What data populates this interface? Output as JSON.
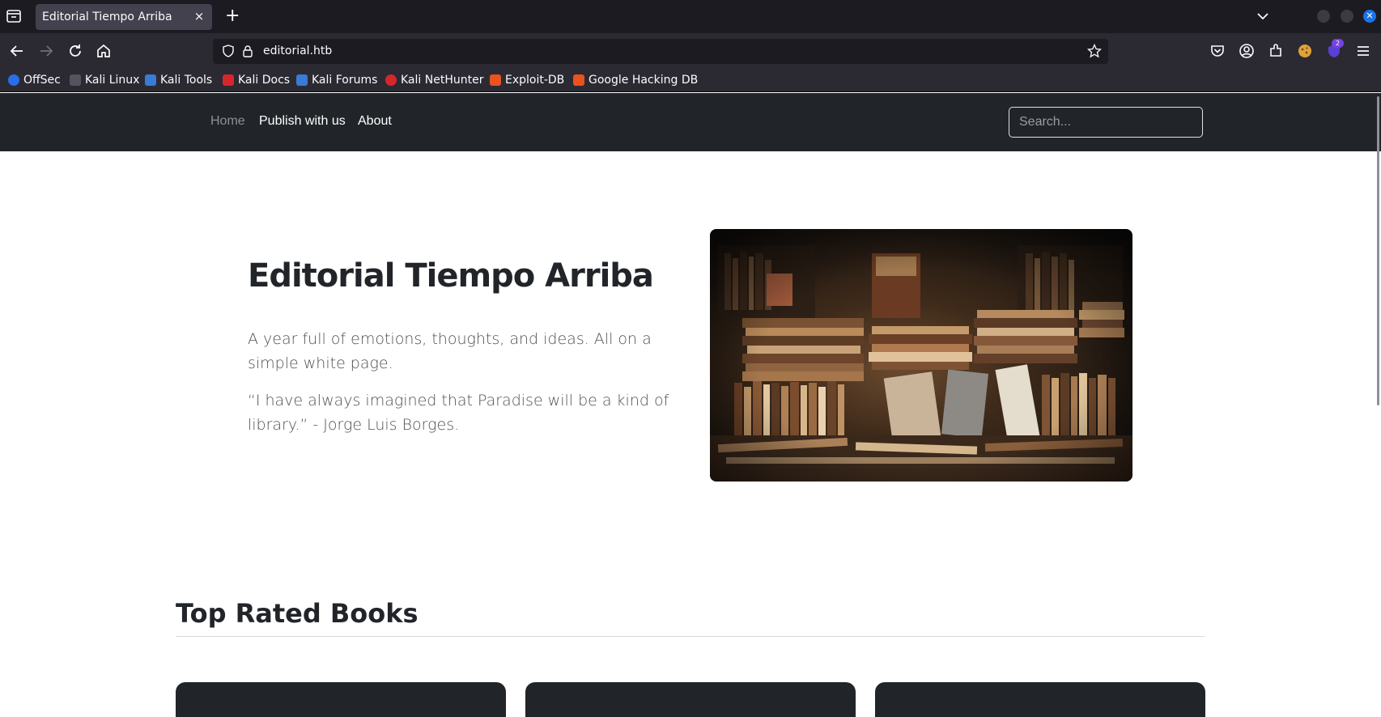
{
  "browser": {
    "tab_title": "Editorial Tiempo Arriba",
    "tab_close_glyph": "×",
    "new_tab_glyph": "+",
    "url": "editorial.htb",
    "extension_badge": "2",
    "bookmarks": [
      {
        "label": "OffSec",
        "color": "#2b6de8"
      },
      {
        "label": "Kali Linux",
        "color": "#2b2a33"
      },
      {
        "label": "Kali Tools",
        "color": "#3a7bd5"
      },
      {
        "label": "Kali Docs",
        "color": "#d6262b"
      },
      {
        "label": "Kali Forums",
        "color": "#3a7bd5"
      },
      {
        "label": "Kali NetHunter",
        "color": "#d6262b"
      },
      {
        "label": "Exploit-DB",
        "color": "#e8531f"
      },
      {
        "label": "Google Hacking DB",
        "color": "#e8531f"
      }
    ]
  },
  "site": {
    "nav": {
      "home": "Home",
      "publish": "Publish with us",
      "about": "About"
    },
    "search": {
      "placeholder": "Search..."
    },
    "hero": {
      "title": "Editorial Tiempo Arriba",
      "lead": "A year full of emotions, thoughts, and ideas. All on a simple white page.",
      "quote": "“I have always imagined that Paradise will be a kind of library.” - Jorge Luis Borges.",
      "image_alt": "stacks of old books in a bookshop"
    },
    "top_rated": {
      "title": "Top Rated Books"
    },
    "colors": {
      "navbar_bg": "#212529",
      "text_dark": "#212529",
      "card_bg": "#212529"
    }
  }
}
